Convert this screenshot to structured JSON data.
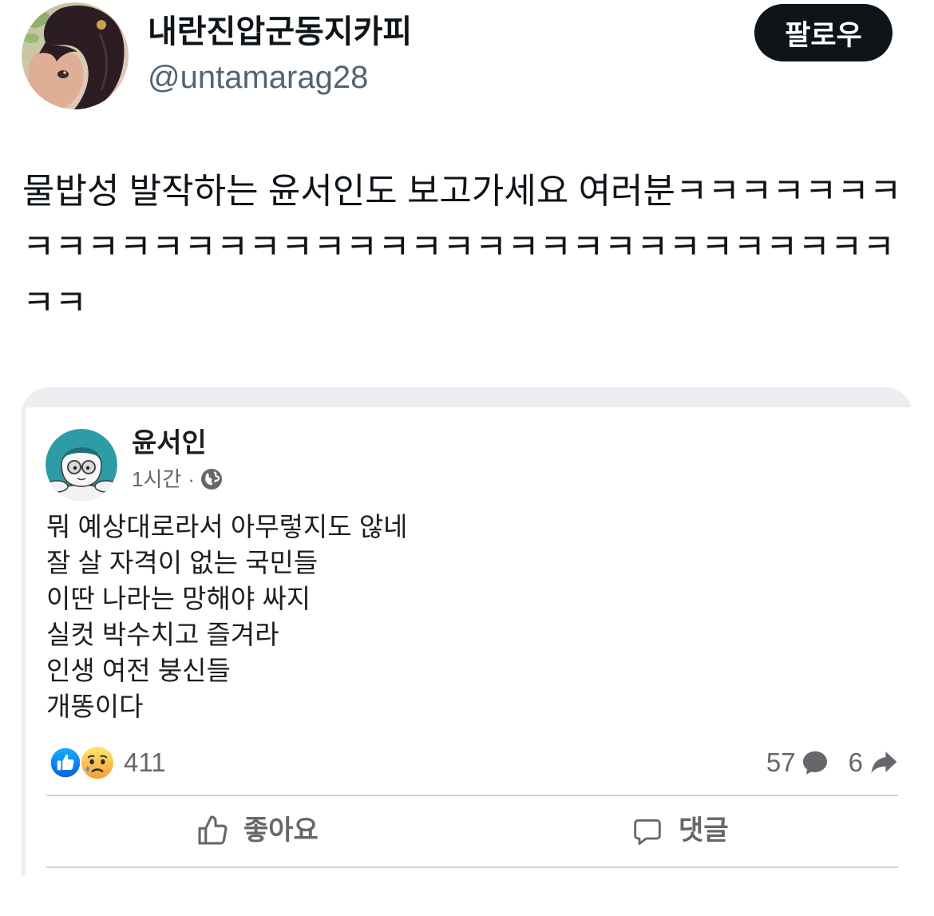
{
  "tweet": {
    "author": {
      "display_name": "내란진압군동지카피",
      "handle": "@untamarag28",
      "avatar_icon": "anime-portrait-avatar"
    },
    "follow_label": "팔로우",
    "text": "물밥성 발작하는 윤서인도 보고가세요 여러분ㅋㅋㅋㅋㅋㅋㅋㅋㅋㅋㅋㅋㅋㅋㅋㅋㅋㅋㅋㅋㅋㅋㅋㅋㅋㅋㅋㅋㅋㅋㅋㅋㅋㅋㅋㅋ"
  },
  "embedded_post": {
    "author_name": "윤서인",
    "avatar_icon": "cartoon-glasses-avatar",
    "timestamp": "1시간",
    "separator": "·",
    "privacy_icon": "globe-icon",
    "lines": [
      "뭐 예상대로라서 아무렇지도 않네",
      "잘 살 자격이 없는 국민들",
      "이딴 나라는 망해야 싸지",
      "실컷 박수치고 즐겨라",
      "인생 여전 붕신들",
      "개똥이다"
    ],
    "reactions": {
      "icons": [
        "like-reaction-icon",
        "sad-reaction-icon"
      ],
      "count": "411"
    },
    "comments": {
      "count": "57",
      "icon": "comment-bubble-icon"
    },
    "shares": {
      "count": "6",
      "icon": "share-arrow-icon"
    },
    "actions": {
      "like_label": "좋아요",
      "like_icon": "thumbs-up-outline-icon",
      "comment_label": "댓글",
      "comment_icon": "comment-outline-icon"
    }
  },
  "colors": {
    "text_primary": "#0f1419",
    "text_secondary": "#536471",
    "follow_button_bg": "#0f1419",
    "follow_button_text": "#ffffff",
    "fb_text": "#1c1e21",
    "fb_secondary_text": "#65676b",
    "like_blue": "#1877f2",
    "divider": "#ced0d4",
    "card_frame": "#ebedf0"
  }
}
